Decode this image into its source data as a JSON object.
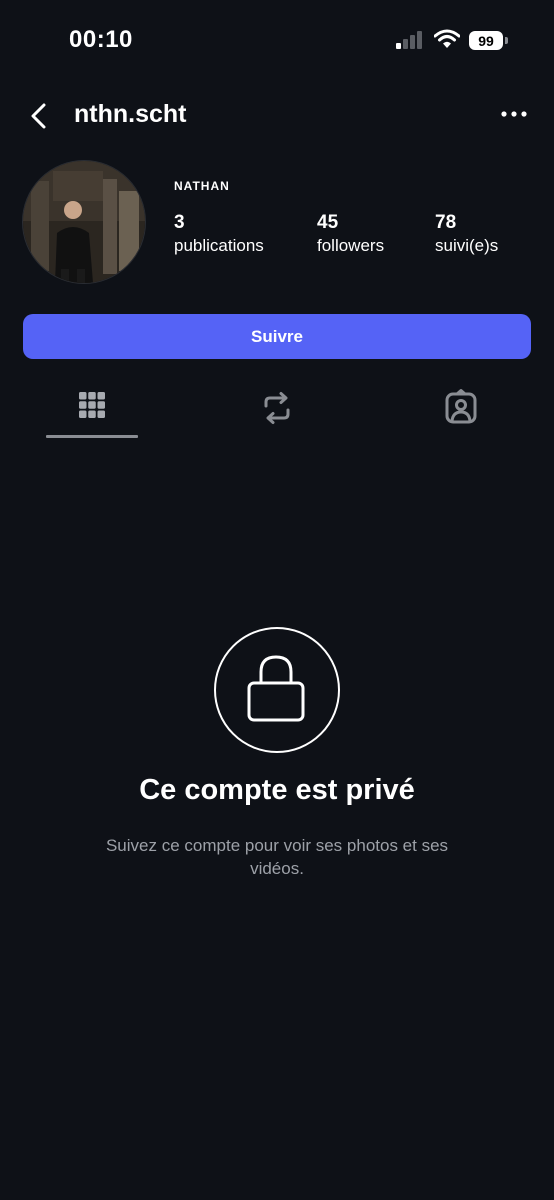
{
  "status_bar": {
    "time": "00:10",
    "battery": "99",
    "icons": [
      "signal-icon",
      "wifi-icon",
      "battery-icon"
    ]
  },
  "header": {
    "username": "nthn.scht",
    "back_icon": "chevron-left-icon",
    "more_icon": "more-horizontal-icon"
  },
  "profile": {
    "display_name": "NATHAN",
    "stats": [
      {
        "value": "3",
        "label": "publications"
      },
      {
        "value": "45",
        "label": "followers"
      },
      {
        "value": "78",
        "label": "suivi(e)s"
      }
    ],
    "follow_label": "Suivre"
  },
  "tabs": [
    {
      "icon": "grid-icon",
      "active": true
    },
    {
      "icon": "repost-icon",
      "active": false
    },
    {
      "icon": "tagged-person-icon",
      "active": false
    }
  ],
  "private": {
    "icon": "lock-icon",
    "title": "Ce compte est privé",
    "description": "Suivez ce compte pour voir ses photos et ses vidéos."
  },
  "colors": {
    "background": "#0e1117",
    "accent": "#5563f6",
    "muted_text": "#9da1a8",
    "inactive_icon": "#8a8d93"
  }
}
